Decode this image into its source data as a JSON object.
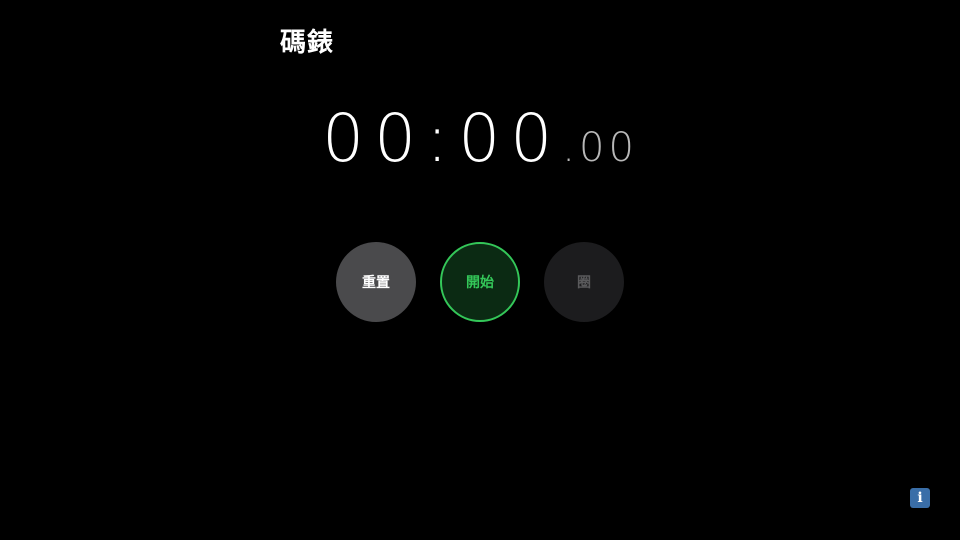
{
  "app": {
    "title": "碼錶"
  },
  "timer": {
    "main": "00:00",
    "fraction": ".00"
  },
  "controls": {
    "reset_label": "重置",
    "start_label": "開始",
    "lap_label": "圈"
  },
  "info": {
    "icon": "i"
  },
  "colors": {
    "background": "#000000",
    "start_accent": "#34c759",
    "reset_bg": "#4a4a4c",
    "lap_bg": "#1c1c1e",
    "info_bg": "#3a6ea8"
  }
}
